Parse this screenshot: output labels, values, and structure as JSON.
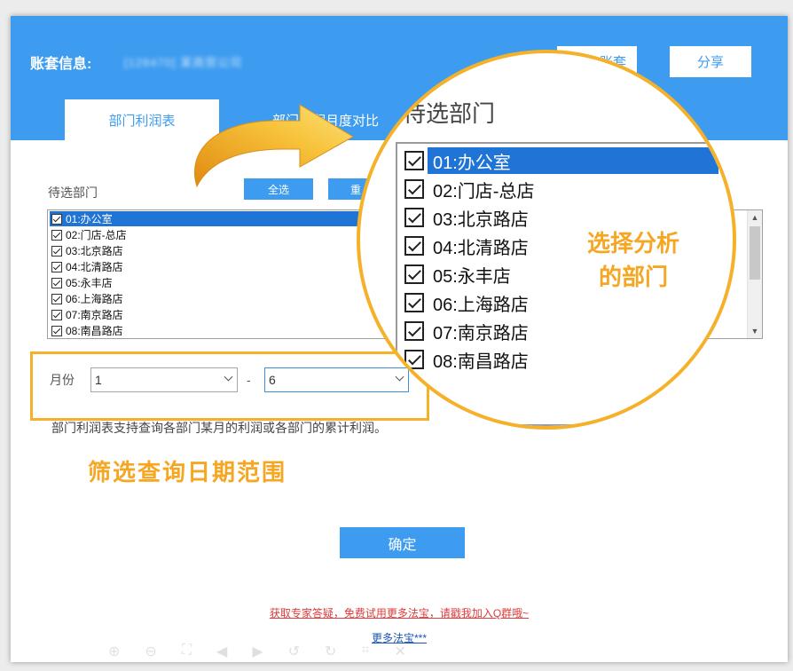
{
  "header": {
    "account_label": "账套信息:",
    "account_name": "[128470] 某商贸公司",
    "switch_button": "账套",
    "share_button": "分享"
  },
  "tabs": [
    {
      "label": "部门利润表",
      "active": true
    },
    {
      "label": "部门利润月度对比",
      "active": false
    }
  ],
  "department_picker": {
    "label": "待选部门",
    "select_all_button": "全选",
    "reset_button": "重",
    "items": [
      {
        "label": "01:办公室",
        "checked": true,
        "selected": true
      },
      {
        "label": "02:门店-总店",
        "checked": true,
        "selected": false
      },
      {
        "label": "03:北京路店",
        "checked": true,
        "selected": false
      },
      {
        "label": "04:北清路店",
        "checked": true,
        "selected": false
      },
      {
        "label": "05:永丰店",
        "checked": true,
        "selected": false
      },
      {
        "label": "06:上海路店",
        "checked": true,
        "selected": false
      },
      {
        "label": "07:南京路店",
        "checked": true,
        "selected": false
      },
      {
        "label": "08:南昌路店",
        "checked": true,
        "selected": false
      }
    ]
  },
  "month_filter": {
    "label": "月份",
    "from_value": "1",
    "separator": "-",
    "to_value": "6"
  },
  "description": "部门利润表支持查询各部门某月的利润或各部门的累计利润。",
  "annotations": {
    "date_range": "筛选查询日期范围",
    "select_departments_line1": "选择分析",
    "select_departments_line2": "的部门"
  },
  "zoom": {
    "title": "待选部门"
  },
  "confirm_button": "确定",
  "promo": {
    "expert_link": "获取专家答疑，免费试用更多法宝，请戳我加入Q群哦~",
    "more_link": "更多法宝***"
  },
  "colors": {
    "header_blue": "#3d9cf0",
    "selection_blue": "#1f74d6",
    "highlight_orange": "#f5b12a",
    "promo_red": "#e03a3a"
  }
}
